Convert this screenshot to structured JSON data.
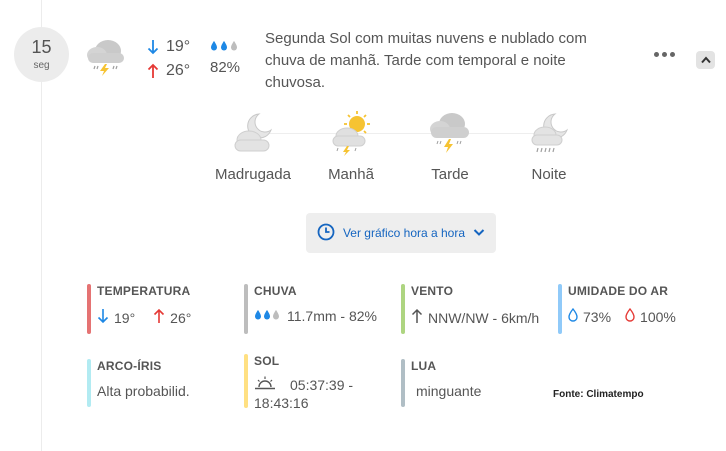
{
  "date": {
    "day": "15",
    "weekday": "seg"
  },
  "summary": {
    "icon": "cloud-lightning-rain-icon",
    "temp_min": "19°",
    "temp_max": "26°",
    "rain_probability": "82%",
    "description": "Segunda Sol com muitas nuvens e nublado com chuva de manhã. Tarde com temporal e noite chuvosa."
  },
  "periods": [
    {
      "label": "Madrugada",
      "icon": "moon-cloud-icon"
    },
    {
      "label": "Manhã",
      "icon": "sun-cloud-storm-icon"
    },
    {
      "label": "Tarde",
      "icon": "cloud-storm-icon"
    },
    {
      "label": "Noite",
      "icon": "moon-cloud-rain-icon"
    }
  ],
  "hourly_button": {
    "label": "Ver gráfico hora a hora"
  },
  "details": {
    "temperature": {
      "title": "TEMPERATURA",
      "min": "19°",
      "max": "26°"
    },
    "rain": {
      "title": "CHUVA",
      "value": "11.7mm - 82%"
    },
    "wind": {
      "title": "VENTO",
      "value": "NNW/NW - 6km/h"
    },
    "humidity": {
      "title": "UMIDADE DO AR",
      "min": "73%",
      "max": "100%"
    },
    "rainbow": {
      "title": "ARCO-ÍRIS",
      "value": "Alta probabilid."
    },
    "sun": {
      "title": "SOL",
      "value_line1": "05:37:39 -",
      "value_line2": "18:43:16"
    },
    "moon": {
      "title": "LUA",
      "value": "minguante"
    }
  },
  "source": "Fonte: Climatempo",
  "colors": {
    "blue": "#1e88e5",
    "red": "#e53935",
    "temperature_bar": "#e57373",
    "rain_bar": "#bdbdbd",
    "wind_bar": "#aed581",
    "humidity_bar": "#90caf9",
    "rainbow_bar": "#b2ebf2",
    "sun_bar": "#ffe082",
    "moon_bar": "#b0bec5"
  }
}
